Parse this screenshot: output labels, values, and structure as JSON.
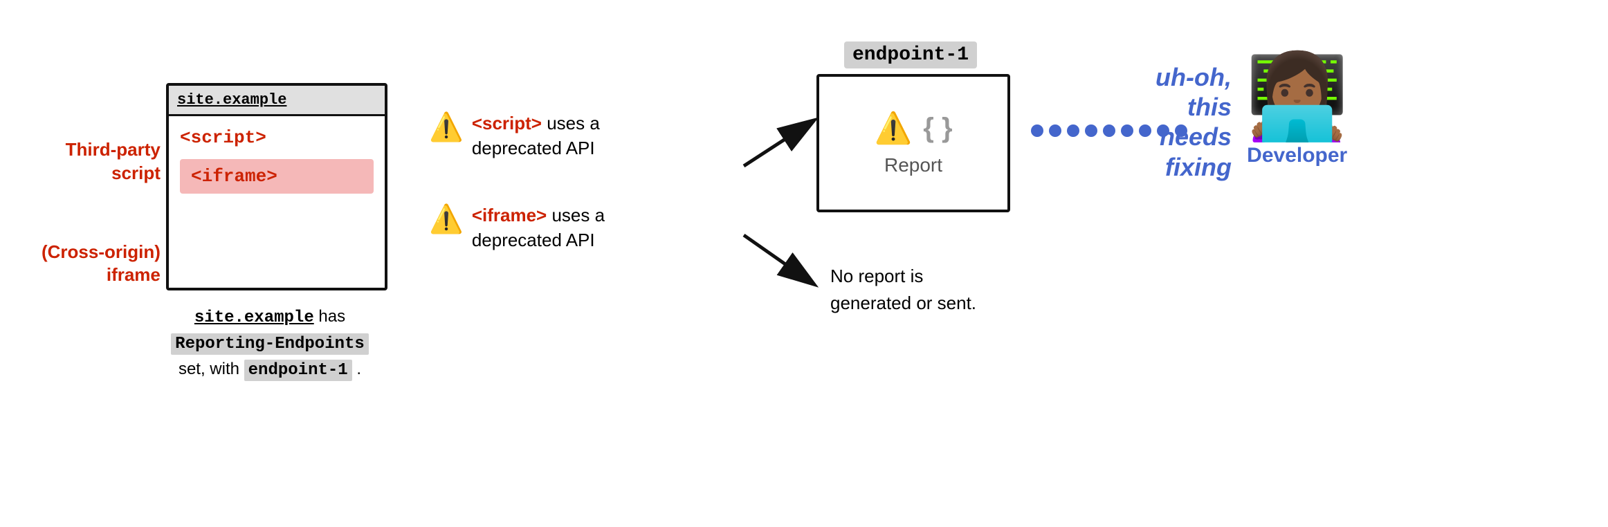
{
  "browser": {
    "title": "site.example",
    "script_tag": "<script>",
    "iframe_tag": "<iframe>"
  },
  "left_labels": [
    {
      "id": "third-party-script-label",
      "text": "Third-party\nscript"
    },
    {
      "id": "cross-origin-iframe-label",
      "text": "(Cross-origin)\niframe"
    }
  ],
  "caption": {
    "line1_plain": "",
    "site_example": "site.example",
    "line1_rest": " has",
    "line2_mono": "Reporting-Endpoints",
    "line3": "set, with ",
    "endpoint_inline": "endpoint-1",
    "line3_end": " ."
  },
  "warnings": [
    {
      "icon": "⚠️",
      "tag": "<script>",
      "text": " uses a\ndeprecated API"
    },
    {
      "icon": "⚠️",
      "tag": "<iframe>",
      "text": " uses a\ndeprecated API"
    }
  ],
  "endpoint": {
    "label": "endpoint-1",
    "report_label": "Report"
  },
  "no_report": {
    "text": "No report is\ngenerated or sent."
  },
  "developer": {
    "uh_oh": "uh-oh,\nthis\nneeds\nfixing",
    "emoji": "👩🏾‍💻",
    "label": "Developer"
  },
  "arrows": {
    "up_arrow": "→",
    "down_arrow": "→"
  }
}
